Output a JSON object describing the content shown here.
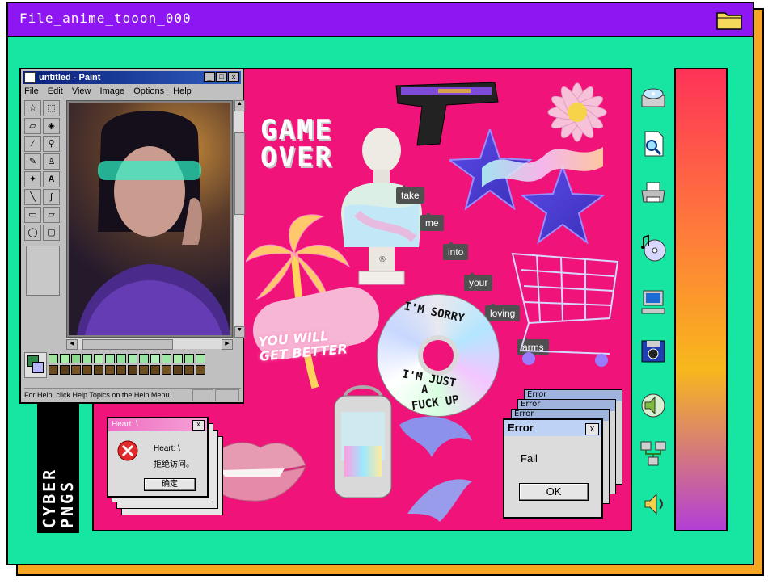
{
  "window": {
    "title": "File_anime_tooon_000"
  },
  "paint": {
    "title": "untitled - Paint",
    "menu": [
      "File",
      "Edit",
      "View",
      "Image",
      "Options",
      "Help"
    ],
    "minimize": "_",
    "maximize": "□",
    "close": "x",
    "status": "For Help, click Help Topics on the Help Menu."
  },
  "collage": {
    "game_over": [
      "GAME",
      "OVER"
    ],
    "tags": [
      "take",
      "me",
      "into",
      "your",
      "loving",
      "arms"
    ],
    "bandage_text": [
      "YOU WILL",
      "GET BETTER"
    ],
    "cd_text": [
      "I'M SORRY",
      "I'M JUST",
      "A",
      "FUCK UP"
    ],
    "bust_mark": "®"
  },
  "heart_dialog": {
    "title": "Heart: \\",
    "message_line1": "Heart: \\",
    "message_line2": "拒绝访问。",
    "button": "确定",
    "close": "x"
  },
  "error_dialog": {
    "title": "Error",
    "message": "Fail",
    "button": "OK",
    "close": "x",
    "stacked_title": "Error"
  },
  "badge": {
    "line1": "CYBER",
    "line2": "PNGS"
  },
  "side_icons": [
    "cd-drive-icon",
    "document-search-icon",
    "printer-icon",
    "music-cd-icon",
    "computer-icon",
    "camera-disk-icon",
    "speaker-cd-icon",
    "network-icon",
    "volume-icon"
  ],
  "colors": {
    "title_bar": "#8d16f3",
    "frame": "#17e6a3",
    "shadow": "#f6a623",
    "collage": "#f0147a"
  }
}
